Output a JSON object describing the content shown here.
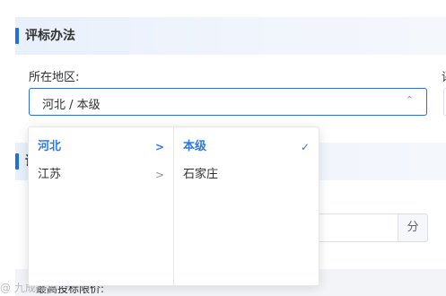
{
  "section1": {
    "title": "评标办法"
  },
  "section2": {
    "title": "评"
  },
  "region_field": {
    "label": "所在地区:",
    "value": "河北 / 本级",
    "arrow_icon": "chevron-up-icon"
  },
  "next_field_label": "评",
  "score": {
    "unit": "分"
  },
  "bottom": {
    "text": "最高投标限价:"
  },
  "watermark": "@ 九成科技",
  "cascader_dropdown": {
    "level1": [
      {
        "label": "河北",
        "active": true,
        "icon": "chevron-right-icon",
        "mark": ">"
      },
      {
        "label": "江苏",
        "active": false,
        "icon": "chevron-right-icon",
        "mark": ">"
      }
    ],
    "level2": [
      {
        "label": "本级",
        "active": true,
        "icon": "check-icon",
        "mark": "✓"
      },
      {
        "label": "石家庄",
        "active": false,
        "icon": "",
        "mark": ""
      }
    ]
  },
  "colors": {
    "accent": "#2d7be0",
    "header_bg": "#e9f0fb",
    "border": "#dcdfe6"
  }
}
